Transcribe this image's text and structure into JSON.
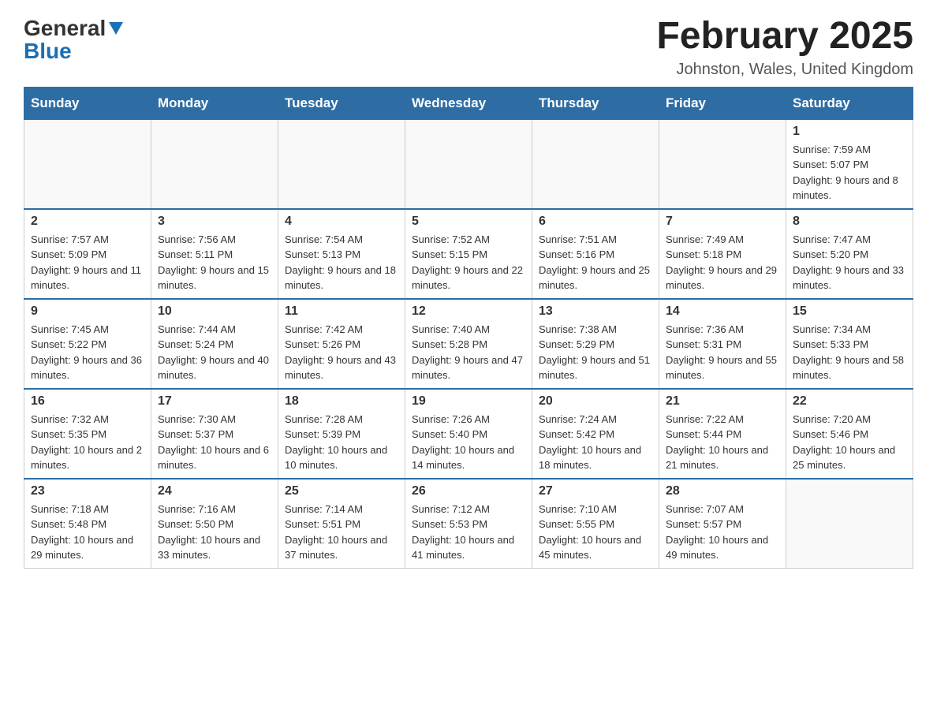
{
  "logo": {
    "general": "General",
    "blue": "Blue"
  },
  "title": "February 2025",
  "subtitle": "Johnston, Wales, United Kingdom",
  "weekdays": [
    "Sunday",
    "Monday",
    "Tuesday",
    "Wednesday",
    "Thursday",
    "Friday",
    "Saturday"
  ],
  "weeks": [
    [
      {
        "day": "",
        "info": ""
      },
      {
        "day": "",
        "info": ""
      },
      {
        "day": "",
        "info": ""
      },
      {
        "day": "",
        "info": ""
      },
      {
        "day": "",
        "info": ""
      },
      {
        "day": "",
        "info": ""
      },
      {
        "day": "1",
        "info": "Sunrise: 7:59 AM\nSunset: 5:07 PM\nDaylight: 9 hours and 8 minutes."
      }
    ],
    [
      {
        "day": "2",
        "info": "Sunrise: 7:57 AM\nSunset: 5:09 PM\nDaylight: 9 hours and 11 minutes."
      },
      {
        "day": "3",
        "info": "Sunrise: 7:56 AM\nSunset: 5:11 PM\nDaylight: 9 hours and 15 minutes."
      },
      {
        "day": "4",
        "info": "Sunrise: 7:54 AM\nSunset: 5:13 PM\nDaylight: 9 hours and 18 minutes."
      },
      {
        "day": "5",
        "info": "Sunrise: 7:52 AM\nSunset: 5:15 PM\nDaylight: 9 hours and 22 minutes."
      },
      {
        "day": "6",
        "info": "Sunrise: 7:51 AM\nSunset: 5:16 PM\nDaylight: 9 hours and 25 minutes."
      },
      {
        "day": "7",
        "info": "Sunrise: 7:49 AM\nSunset: 5:18 PM\nDaylight: 9 hours and 29 minutes."
      },
      {
        "day": "8",
        "info": "Sunrise: 7:47 AM\nSunset: 5:20 PM\nDaylight: 9 hours and 33 minutes."
      }
    ],
    [
      {
        "day": "9",
        "info": "Sunrise: 7:45 AM\nSunset: 5:22 PM\nDaylight: 9 hours and 36 minutes."
      },
      {
        "day": "10",
        "info": "Sunrise: 7:44 AM\nSunset: 5:24 PM\nDaylight: 9 hours and 40 minutes."
      },
      {
        "day": "11",
        "info": "Sunrise: 7:42 AM\nSunset: 5:26 PM\nDaylight: 9 hours and 43 minutes."
      },
      {
        "day": "12",
        "info": "Sunrise: 7:40 AM\nSunset: 5:28 PM\nDaylight: 9 hours and 47 minutes."
      },
      {
        "day": "13",
        "info": "Sunrise: 7:38 AM\nSunset: 5:29 PM\nDaylight: 9 hours and 51 minutes."
      },
      {
        "day": "14",
        "info": "Sunrise: 7:36 AM\nSunset: 5:31 PM\nDaylight: 9 hours and 55 minutes."
      },
      {
        "day": "15",
        "info": "Sunrise: 7:34 AM\nSunset: 5:33 PM\nDaylight: 9 hours and 58 minutes."
      }
    ],
    [
      {
        "day": "16",
        "info": "Sunrise: 7:32 AM\nSunset: 5:35 PM\nDaylight: 10 hours and 2 minutes."
      },
      {
        "day": "17",
        "info": "Sunrise: 7:30 AM\nSunset: 5:37 PM\nDaylight: 10 hours and 6 minutes."
      },
      {
        "day": "18",
        "info": "Sunrise: 7:28 AM\nSunset: 5:39 PM\nDaylight: 10 hours and 10 minutes."
      },
      {
        "day": "19",
        "info": "Sunrise: 7:26 AM\nSunset: 5:40 PM\nDaylight: 10 hours and 14 minutes."
      },
      {
        "day": "20",
        "info": "Sunrise: 7:24 AM\nSunset: 5:42 PM\nDaylight: 10 hours and 18 minutes."
      },
      {
        "day": "21",
        "info": "Sunrise: 7:22 AM\nSunset: 5:44 PM\nDaylight: 10 hours and 21 minutes."
      },
      {
        "day": "22",
        "info": "Sunrise: 7:20 AM\nSunset: 5:46 PM\nDaylight: 10 hours and 25 minutes."
      }
    ],
    [
      {
        "day": "23",
        "info": "Sunrise: 7:18 AM\nSunset: 5:48 PM\nDaylight: 10 hours and 29 minutes."
      },
      {
        "day": "24",
        "info": "Sunrise: 7:16 AM\nSunset: 5:50 PM\nDaylight: 10 hours and 33 minutes."
      },
      {
        "day": "25",
        "info": "Sunrise: 7:14 AM\nSunset: 5:51 PM\nDaylight: 10 hours and 37 minutes."
      },
      {
        "day": "26",
        "info": "Sunrise: 7:12 AM\nSunset: 5:53 PM\nDaylight: 10 hours and 41 minutes."
      },
      {
        "day": "27",
        "info": "Sunrise: 7:10 AM\nSunset: 5:55 PM\nDaylight: 10 hours and 45 minutes."
      },
      {
        "day": "28",
        "info": "Sunrise: 7:07 AM\nSunset: 5:57 PM\nDaylight: 10 hours and 49 minutes."
      },
      {
        "day": "",
        "info": ""
      }
    ]
  ]
}
